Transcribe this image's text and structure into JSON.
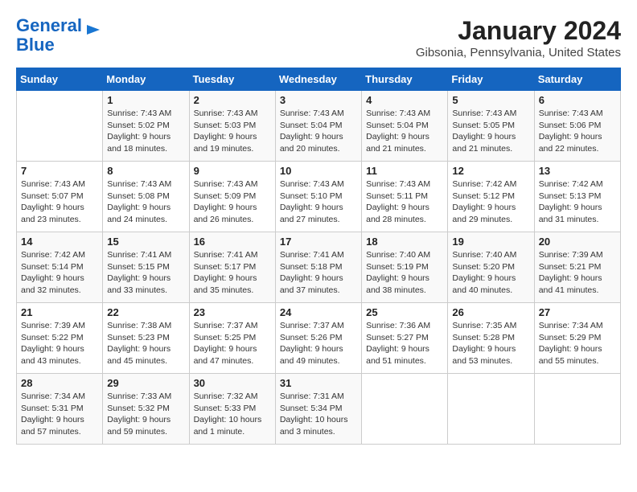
{
  "logo": {
    "line1": "General",
    "line2": "Blue"
  },
  "title": "January 2024",
  "location": "Gibsonia, Pennsylvania, United States",
  "weekdays": [
    "Sunday",
    "Monday",
    "Tuesday",
    "Wednesday",
    "Thursday",
    "Friday",
    "Saturday"
  ],
  "weeks": [
    [
      {
        "day": "",
        "sunrise": "",
        "sunset": "",
        "daylight": ""
      },
      {
        "day": "1",
        "sunrise": "Sunrise: 7:43 AM",
        "sunset": "Sunset: 5:02 PM",
        "daylight": "Daylight: 9 hours and 18 minutes."
      },
      {
        "day": "2",
        "sunrise": "Sunrise: 7:43 AM",
        "sunset": "Sunset: 5:03 PM",
        "daylight": "Daylight: 9 hours and 19 minutes."
      },
      {
        "day": "3",
        "sunrise": "Sunrise: 7:43 AM",
        "sunset": "Sunset: 5:04 PM",
        "daylight": "Daylight: 9 hours and 20 minutes."
      },
      {
        "day": "4",
        "sunrise": "Sunrise: 7:43 AM",
        "sunset": "Sunset: 5:04 PM",
        "daylight": "Daylight: 9 hours and 21 minutes."
      },
      {
        "day": "5",
        "sunrise": "Sunrise: 7:43 AM",
        "sunset": "Sunset: 5:05 PM",
        "daylight": "Daylight: 9 hours and 21 minutes."
      },
      {
        "day": "6",
        "sunrise": "Sunrise: 7:43 AM",
        "sunset": "Sunset: 5:06 PM",
        "daylight": "Daylight: 9 hours and 22 minutes."
      }
    ],
    [
      {
        "day": "7",
        "sunrise": "Sunrise: 7:43 AM",
        "sunset": "Sunset: 5:07 PM",
        "daylight": "Daylight: 9 hours and 23 minutes."
      },
      {
        "day": "8",
        "sunrise": "Sunrise: 7:43 AM",
        "sunset": "Sunset: 5:08 PM",
        "daylight": "Daylight: 9 hours and 24 minutes."
      },
      {
        "day": "9",
        "sunrise": "Sunrise: 7:43 AM",
        "sunset": "Sunset: 5:09 PM",
        "daylight": "Daylight: 9 hours and 26 minutes."
      },
      {
        "day": "10",
        "sunrise": "Sunrise: 7:43 AM",
        "sunset": "Sunset: 5:10 PM",
        "daylight": "Daylight: 9 hours and 27 minutes."
      },
      {
        "day": "11",
        "sunrise": "Sunrise: 7:43 AM",
        "sunset": "Sunset: 5:11 PM",
        "daylight": "Daylight: 9 hours and 28 minutes."
      },
      {
        "day": "12",
        "sunrise": "Sunrise: 7:42 AM",
        "sunset": "Sunset: 5:12 PM",
        "daylight": "Daylight: 9 hours and 29 minutes."
      },
      {
        "day": "13",
        "sunrise": "Sunrise: 7:42 AM",
        "sunset": "Sunset: 5:13 PM",
        "daylight": "Daylight: 9 hours and 31 minutes."
      }
    ],
    [
      {
        "day": "14",
        "sunrise": "Sunrise: 7:42 AM",
        "sunset": "Sunset: 5:14 PM",
        "daylight": "Daylight: 9 hours and 32 minutes."
      },
      {
        "day": "15",
        "sunrise": "Sunrise: 7:41 AM",
        "sunset": "Sunset: 5:15 PM",
        "daylight": "Daylight: 9 hours and 33 minutes."
      },
      {
        "day": "16",
        "sunrise": "Sunrise: 7:41 AM",
        "sunset": "Sunset: 5:17 PM",
        "daylight": "Daylight: 9 hours and 35 minutes."
      },
      {
        "day": "17",
        "sunrise": "Sunrise: 7:41 AM",
        "sunset": "Sunset: 5:18 PM",
        "daylight": "Daylight: 9 hours and 37 minutes."
      },
      {
        "day": "18",
        "sunrise": "Sunrise: 7:40 AM",
        "sunset": "Sunset: 5:19 PM",
        "daylight": "Daylight: 9 hours and 38 minutes."
      },
      {
        "day": "19",
        "sunrise": "Sunrise: 7:40 AM",
        "sunset": "Sunset: 5:20 PM",
        "daylight": "Daylight: 9 hours and 40 minutes."
      },
      {
        "day": "20",
        "sunrise": "Sunrise: 7:39 AM",
        "sunset": "Sunset: 5:21 PM",
        "daylight": "Daylight: 9 hours and 41 minutes."
      }
    ],
    [
      {
        "day": "21",
        "sunrise": "Sunrise: 7:39 AM",
        "sunset": "Sunset: 5:22 PM",
        "daylight": "Daylight: 9 hours and 43 minutes."
      },
      {
        "day": "22",
        "sunrise": "Sunrise: 7:38 AM",
        "sunset": "Sunset: 5:23 PM",
        "daylight": "Daylight: 9 hours and 45 minutes."
      },
      {
        "day": "23",
        "sunrise": "Sunrise: 7:37 AM",
        "sunset": "Sunset: 5:25 PM",
        "daylight": "Daylight: 9 hours and 47 minutes."
      },
      {
        "day": "24",
        "sunrise": "Sunrise: 7:37 AM",
        "sunset": "Sunset: 5:26 PM",
        "daylight": "Daylight: 9 hours and 49 minutes."
      },
      {
        "day": "25",
        "sunrise": "Sunrise: 7:36 AM",
        "sunset": "Sunset: 5:27 PM",
        "daylight": "Daylight: 9 hours and 51 minutes."
      },
      {
        "day": "26",
        "sunrise": "Sunrise: 7:35 AM",
        "sunset": "Sunset: 5:28 PM",
        "daylight": "Daylight: 9 hours and 53 minutes."
      },
      {
        "day": "27",
        "sunrise": "Sunrise: 7:34 AM",
        "sunset": "Sunset: 5:29 PM",
        "daylight": "Daylight: 9 hours and 55 minutes."
      }
    ],
    [
      {
        "day": "28",
        "sunrise": "Sunrise: 7:34 AM",
        "sunset": "Sunset: 5:31 PM",
        "daylight": "Daylight: 9 hours and 57 minutes."
      },
      {
        "day": "29",
        "sunrise": "Sunrise: 7:33 AM",
        "sunset": "Sunset: 5:32 PM",
        "daylight": "Daylight: 9 hours and 59 minutes."
      },
      {
        "day": "30",
        "sunrise": "Sunrise: 7:32 AM",
        "sunset": "Sunset: 5:33 PM",
        "daylight": "Daylight: 10 hours and 1 minute."
      },
      {
        "day": "31",
        "sunrise": "Sunrise: 7:31 AM",
        "sunset": "Sunset: 5:34 PM",
        "daylight": "Daylight: 10 hours and 3 minutes."
      },
      {
        "day": "",
        "sunrise": "",
        "sunset": "",
        "daylight": ""
      },
      {
        "day": "",
        "sunrise": "",
        "sunset": "",
        "daylight": ""
      },
      {
        "day": "",
        "sunrise": "",
        "sunset": "",
        "daylight": ""
      }
    ]
  ]
}
